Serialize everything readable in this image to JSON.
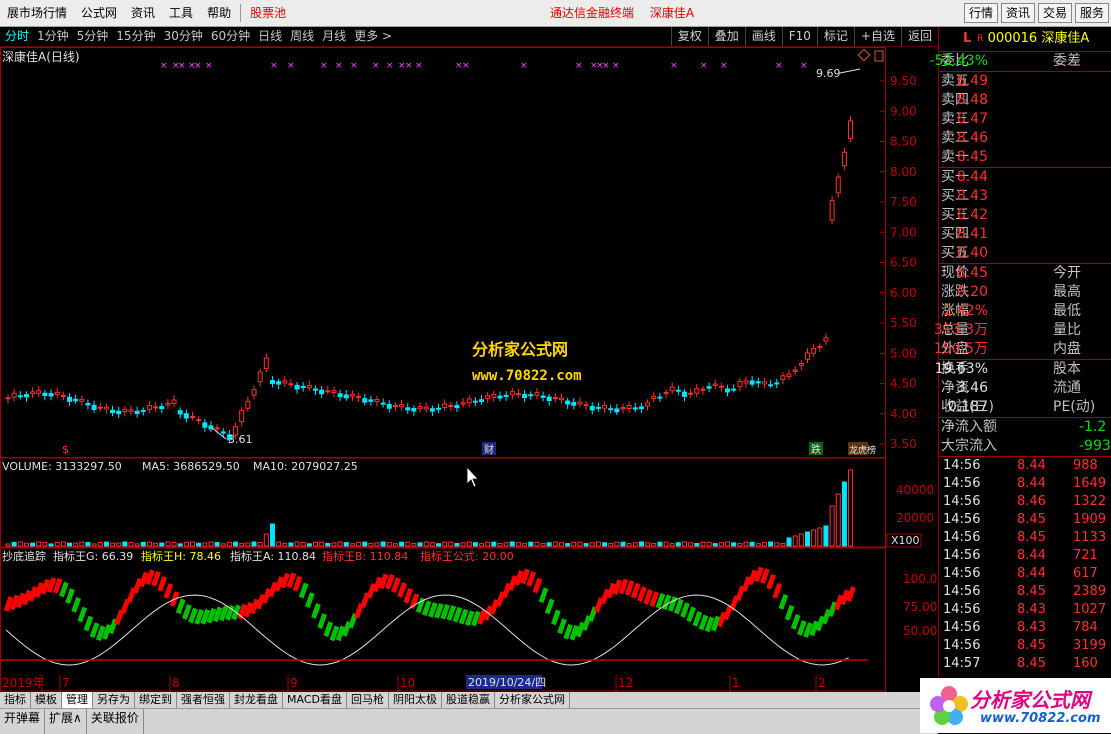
{
  "topmenu": {
    "items": [
      "展市场行情",
      "公式网",
      "资讯",
      "工具",
      "帮助"
    ],
    "highlight": "股票池",
    "center": [
      "通达信金融终端",
      "深康佳A"
    ],
    "right_buttons": [
      "行情",
      "资讯",
      "交易",
      "服务"
    ]
  },
  "periods": {
    "items": [
      "分时",
      "1分钟",
      "5分钟",
      "15分钟",
      "30分钟",
      "60分钟",
      "日线",
      "周线",
      "月线",
      "更多 >"
    ],
    "active": 0
  },
  "tools": [
    "复权",
    "叠加",
    "画线",
    "F10",
    "标记",
    "+自选",
    "返回"
  ],
  "chart": {
    "title": "深康佳A(日线)",
    "high_label": "9.69",
    "low_label": "3.61",
    "price_ticks": [
      "9.50",
      "9.00",
      "8.50",
      "8.00",
      "7.50",
      "7.00",
      "6.50",
      "6.00",
      "5.50",
      "5.00",
      "4.50",
      "4.00",
      "3.50"
    ],
    "markers": {
      "s": "$",
      "cai": "财",
      "die": "跌",
      "bang": "龙虎榜"
    },
    "volume_label": "VOLUME: 3133297.50",
    "ma5_label": "MA5: 3686529.50",
    "ma10_label": "MA10: 2079027.25",
    "volume_ticks": [
      "40000",
      "20000"
    ],
    "volume_unit": "X100",
    "indicator_name": "抄底追踪",
    "ind_g": "指标王G: 66.39",
    "ind_h": "指标王H: 78.46",
    "ind_a": "指标王A: 110.84",
    "ind_b": "指标王B: 110.84",
    "ind_formula": "指标王公式: 20.00",
    "ind_ticks": [
      "100.0",
      "75.00",
      "50.00"
    ],
    "date_labels": [
      "2019年",
      "7",
      "8",
      "9",
      "10",
      "12",
      "1",
      "2"
    ],
    "cursor_date": "2019/10/24/四",
    "colors": {
      "up": "#ff3030",
      "down": "#00e5ff",
      "ind_up": "#ff0000",
      "ind_down": "#00c000"
    }
  },
  "watermark": {
    "line1": "分析家公式网",
    "line2": "www.70822.com"
  },
  "tabs": {
    "items": [
      "指标",
      "模板",
      "管理",
      "另存为",
      "绑定到",
      "强者恒强",
      "封龙看盘",
      "MACD看盘",
      "回马枪",
      "阴阳太极",
      "股道稳赢",
      "分析家公式网"
    ],
    "active": 2
  },
  "status": [
    "开弹幕",
    "扩展∧",
    "关联报价"
  ],
  "panel": {
    "L": "L",
    "R": "R",
    "code": "000016",
    "name": "深康佳A",
    "weibi_label": "委比",
    "weibi": "-52.43%",
    "weicha_label": "委差",
    "asks": [
      {
        "label": "卖五",
        "price": "8.49"
      },
      {
        "label": "卖四",
        "price": "8.48"
      },
      {
        "label": "卖三",
        "price": "8.47"
      },
      {
        "label": "卖二",
        "price": "8.46"
      },
      {
        "label": "卖一",
        "price": "8.45"
      }
    ],
    "bids": [
      {
        "label": "买一",
        "price": "8.44"
      },
      {
        "label": "买二",
        "price": "8.43"
      },
      {
        "label": "买三",
        "price": "8.42"
      },
      {
        "label": "买四",
        "price": "8.41"
      },
      {
        "label": "买五",
        "price": "8.40"
      }
    ],
    "stats1": [
      {
        "label": "现价",
        "value": "8.45",
        "label2": "今开"
      },
      {
        "label": "涨跌",
        "value": "0.20",
        "label2": "最高"
      },
      {
        "label": "涨幅",
        "value": "2.42%",
        "label2": "最低"
      },
      {
        "label": "总量",
        "value": "313.3万",
        "label2": "量比"
      },
      {
        "label": "外盘",
        "value": "150.5万",
        "label2": "内盘"
      }
    ],
    "stats2": [
      {
        "label": "换手",
        "value": "19.63%",
        "label2": "股本"
      },
      {
        "label": "净资",
        "value": "3.46",
        "label2": "流通"
      },
      {
        "label": "收益(三)",
        "value": "0.187",
        "label2": "PE(动)"
      }
    ],
    "flows": [
      {
        "label": "净流入额",
        "value": "-1.2"
      },
      {
        "label": "大宗流入",
        "value": "-993"
      }
    ],
    "ticks": [
      {
        "time": "14:56",
        "price": "8.44",
        "vol": "988"
      },
      {
        "time": "14:56",
        "price": "8.44",
        "vol": "1649"
      },
      {
        "time": "14:56",
        "price": "8.46",
        "vol": "1322"
      },
      {
        "time": "14:56",
        "price": "8.45",
        "vol": "1909"
      },
      {
        "time": "14:56",
        "price": "8.45",
        "vol": "1133"
      },
      {
        "time": "14:56",
        "price": "8.44",
        "vol": "721"
      },
      {
        "time": "14:56",
        "price": "8.44",
        "vol": "617"
      },
      {
        "time": "14:56",
        "price": "8.45",
        "vol": "2389"
      },
      {
        "time": "14:56",
        "price": "8.43",
        "vol": "1027"
      },
      {
        "time": "14:56",
        "price": "8.43",
        "vol": "784"
      },
      {
        "time": "14:56",
        "price": "8.45",
        "vol": "3199"
      },
      {
        "time": "14:57",
        "price": "8.45",
        "vol": "160"
      }
    ]
  },
  "brand": {
    "line1": "分析家公式网",
    "line2": "www.70822.com"
  }
}
